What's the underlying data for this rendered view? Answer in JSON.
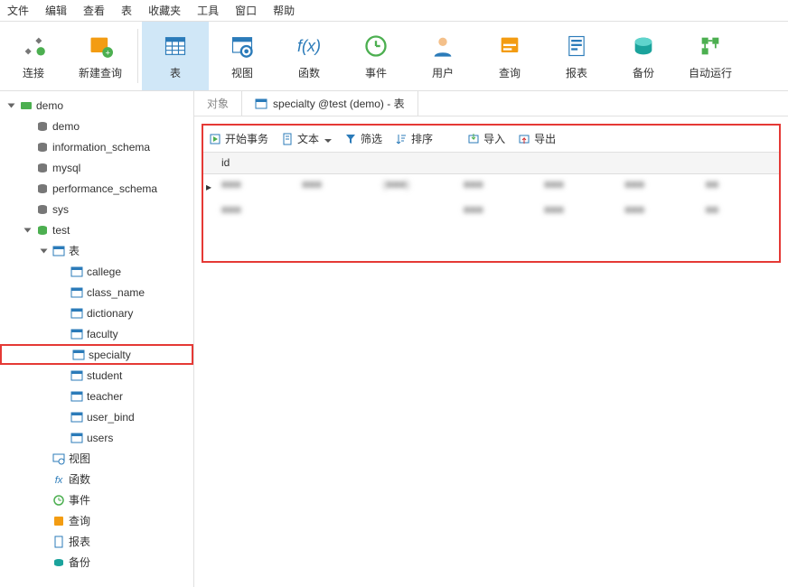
{
  "menu": {
    "items": [
      "文件",
      "编辑",
      "查看",
      "表",
      "收藏夹",
      "工具",
      "窗口",
      "帮助"
    ]
  },
  "toolbar": {
    "connect": "连接",
    "new_query": "新建查询",
    "table": "表",
    "view": "视图",
    "function": "函数",
    "event": "事件",
    "user": "用户",
    "query": "查询",
    "report": "报表",
    "backup": "备份",
    "autorun": "自动运行"
  },
  "tree": {
    "root": "demo",
    "dbs": [
      "demo",
      "information_schema",
      "mysql",
      "performance_schema",
      "sys"
    ],
    "testdb": "test",
    "table_node": "表",
    "tables": [
      "callege",
      "class_name",
      "dictionary",
      "faculty",
      "specialty",
      "student",
      "teacher",
      "user_bind",
      "users"
    ],
    "selected_table": "specialty",
    "other_nodes": {
      "view": "视图",
      "func": "函数",
      "event": "事件",
      "query": "查询",
      "report": "报表",
      "backup": "备份"
    }
  },
  "tabs": {
    "objects": "对象",
    "active": "specialty @test (demo) - 表"
  },
  "data_toolbar": {
    "begin_tx": "开始事务",
    "text": "文本",
    "filter": "筛选",
    "sort": "排序",
    "import": "导入",
    "export": "导出"
  },
  "table_grid": {
    "header": [
      "id",
      "",
      "",
      "",
      "",
      "",
      ""
    ],
    "rows": [
      [
        "■■■",
        "■■■",
        "(■■■)",
        "■■■",
        "■■■",
        "■■■",
        "■■"
      ],
      [
        "■■■",
        "",
        "",
        "■■■",
        "■■■",
        "■■■",
        "■■"
      ]
    ]
  }
}
